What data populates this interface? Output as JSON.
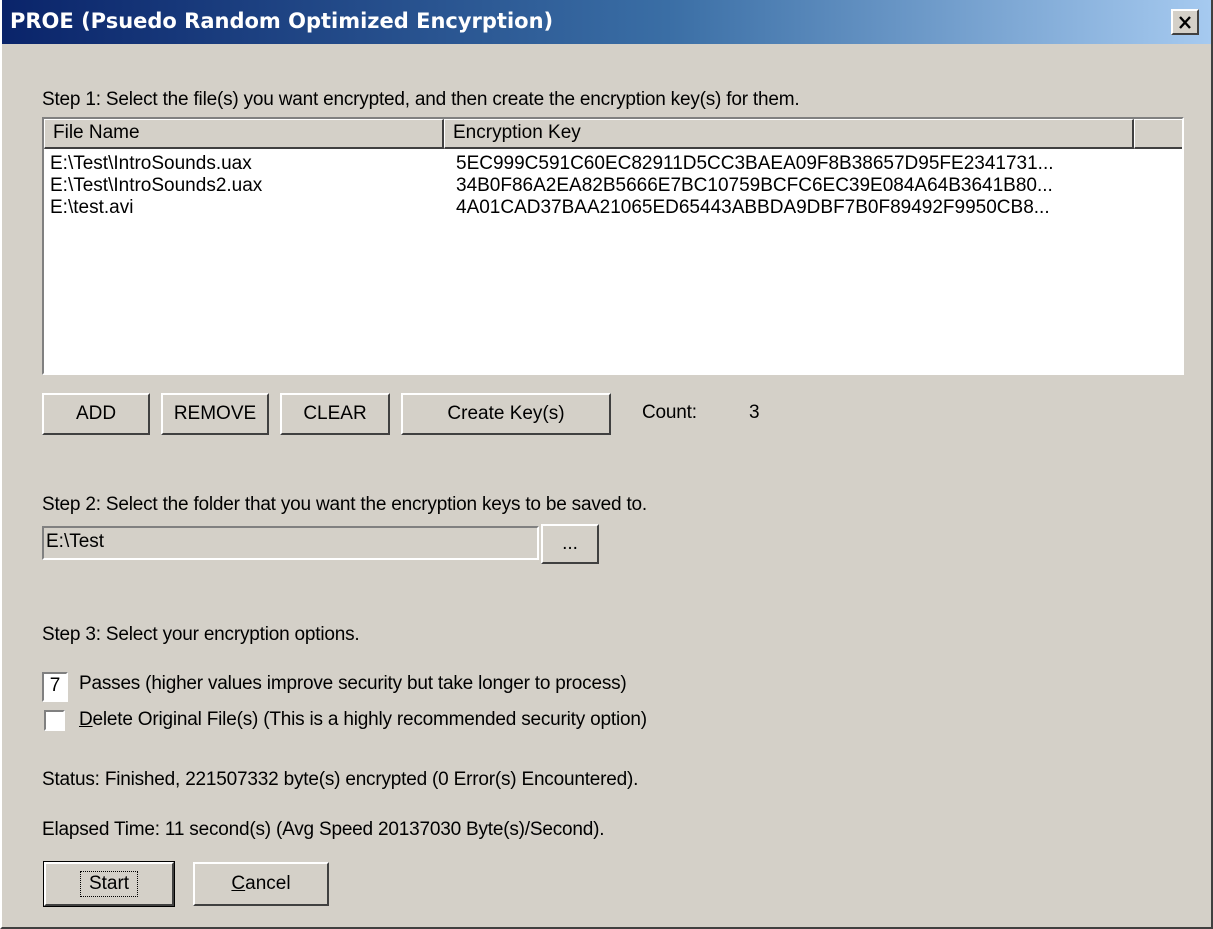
{
  "window": {
    "title": "PROE (Psuedo Random Optimized Encyrption)",
    "close_symbol": "✕"
  },
  "step1": {
    "label": "Step 1: Select the file(s) you want encrypted, and then create the encryption key(s) for them.",
    "columns": [
      "File Name",
      "Encryption Key"
    ],
    "rows": [
      {
        "file": "E:\\Test\\IntroSounds.uax",
        "key": "5EC999C591C60EC82911D5CC3BAEA09F8B38657D95FE2341731..."
      },
      {
        "file": "E:\\Test\\IntroSounds2.uax",
        "key": "34B0F86A2EA82B5666E7BC10759BCFC6EC39E084A64B3641B80..."
      },
      {
        "file": "E:\\test.avi",
        "key": "4A01CAD37BAA21065ED65443ABBDA9DBF7B0F89492F9950CB8..."
      }
    ],
    "buttons": {
      "add": "ADD",
      "remove": "REMOVE",
      "clear": "CLEAR",
      "create_keys": "Create Key(s)"
    },
    "count_label": "Count:",
    "count_value": "3"
  },
  "step2": {
    "label": "Step 2: Select the folder that you want the encryption keys to be saved to.",
    "folder_value": "E:\\Test",
    "browse_label": "..."
  },
  "step3": {
    "label": "Step 3: Select your encryption options.",
    "passes_value": "7",
    "passes_label": "Passes (higher values improve security but take longer to process)",
    "delete_label_accel": "D",
    "delete_label_rest": "elete Original File(s) (This is a highly recommended security option)",
    "delete_checked": false
  },
  "status": {
    "status_text": "Status: Finished, 221507332 byte(s) encrypted (0 Error(s) Encountered).",
    "elapsed_text": "Elapsed Time: 11 second(s) (Avg Speed 20137030 Byte(s)/Second)."
  },
  "footer": {
    "start_label": "Start",
    "cancel_accel": "C",
    "cancel_rest": "ancel"
  }
}
